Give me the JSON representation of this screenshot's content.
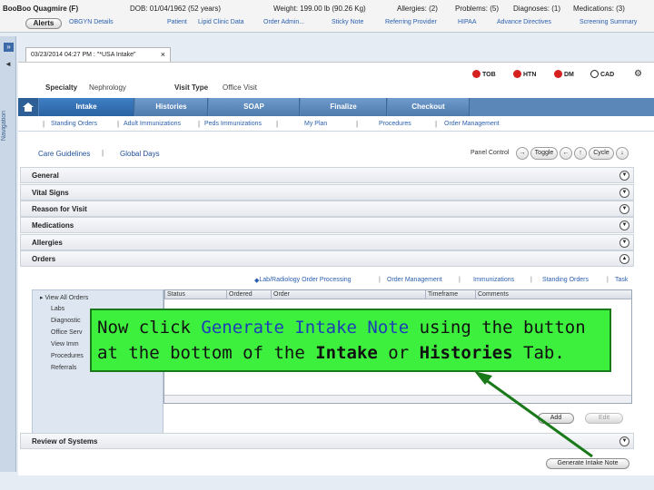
{
  "banner": {
    "patient_name": "BooBoo Quagmire (F)",
    "dob": "DOB: 01/04/1962 (52 years)",
    "weight": "Weight: 199.00 lb (90.26 Kg)",
    "allergies": "Allergies: (2)",
    "problems": "Problems: (5)",
    "diagnoses": "Diagnoses: (1)",
    "medications": "Medications: (3)",
    "alerts_label": "Alerts",
    "links": [
      "OBGYN Details",
      "Patient",
      "Lipid Clinic Data",
      "Order Admin...",
      "Sticky Note",
      "Referring Provider",
      "HIPAA",
      "Advance Directives",
      "Screening Summary"
    ]
  },
  "rail": {
    "expand_label": "»",
    "pin_label": "◄",
    "vertical_text": "Navigation"
  },
  "doc_tab": {
    "label": "03/23/2014 04:27 PM : \"*USA Intake\"",
    "close_label": "×"
  },
  "encounter": {
    "specialty_label": "Specialty",
    "specialty_value": "Nephrology",
    "visit_type_label": "Visit Type",
    "visit_type_value": "Office Visit",
    "status_pills": [
      {
        "label": "TOB",
        "color": "#d62020"
      },
      {
        "label": "HTN",
        "color": "#d62020"
      },
      {
        "label": "DM",
        "color": "#d62020"
      },
      {
        "label": "CAD",
        "color": "#ffffff"
      }
    ]
  },
  "main_tabs": [
    {
      "label": "Intake",
      "active": true
    },
    {
      "label": "Histories",
      "active": false
    },
    {
      "label": "SOAP",
      "active": false
    },
    {
      "label": "Finalize",
      "active": false
    },
    {
      "label": "Checkout",
      "active": false
    }
  ],
  "sub_tabs": [
    "Standing Orders",
    "Adult Immunizations",
    "Peds Immunizations",
    "My Plan",
    "Procedures",
    "Order Management"
  ],
  "care": {
    "guidelines": "Care Guidelines",
    "global_days": "Global Days",
    "panel_control": "Panel Control",
    "toggle": "Toggle",
    "cycle": "Cycle"
  },
  "sections": [
    "General",
    "Vital Signs",
    "Reason for Visit",
    "Medications",
    "Allergies",
    "Orders"
  ],
  "orders": {
    "links": [
      "Lab/Radiology Order Processing",
      "Order Management",
      "Immunizations",
      "Standing Orders",
      "Task"
    ],
    "nav": [
      "View All Orders",
      "Labs",
      "Diagnostic",
      "Office Serv",
      "View Imm",
      "Procedures",
      "Referrals"
    ],
    "columns": [
      "Status",
      "Ordered",
      "Order",
      "Timeframe",
      "Comments"
    ],
    "add_label": "Add",
    "edit_label": "Edit"
  },
  "review_of_systems": "Review of Systems",
  "generate_button": "Generate Intake Note",
  "callout": {
    "part1": "Now click ",
    "part2": "Generate Intake Note",
    "part3": " using the button at the bottom of the ",
    "part4": "Intake",
    "part5": " or ",
    "part6": "Histories",
    "part7": " Tab."
  },
  "colors": {
    "tab_bar": "#5a86b8",
    "callout_bg": "#3df03d",
    "arrow": "#1a7a1a"
  }
}
